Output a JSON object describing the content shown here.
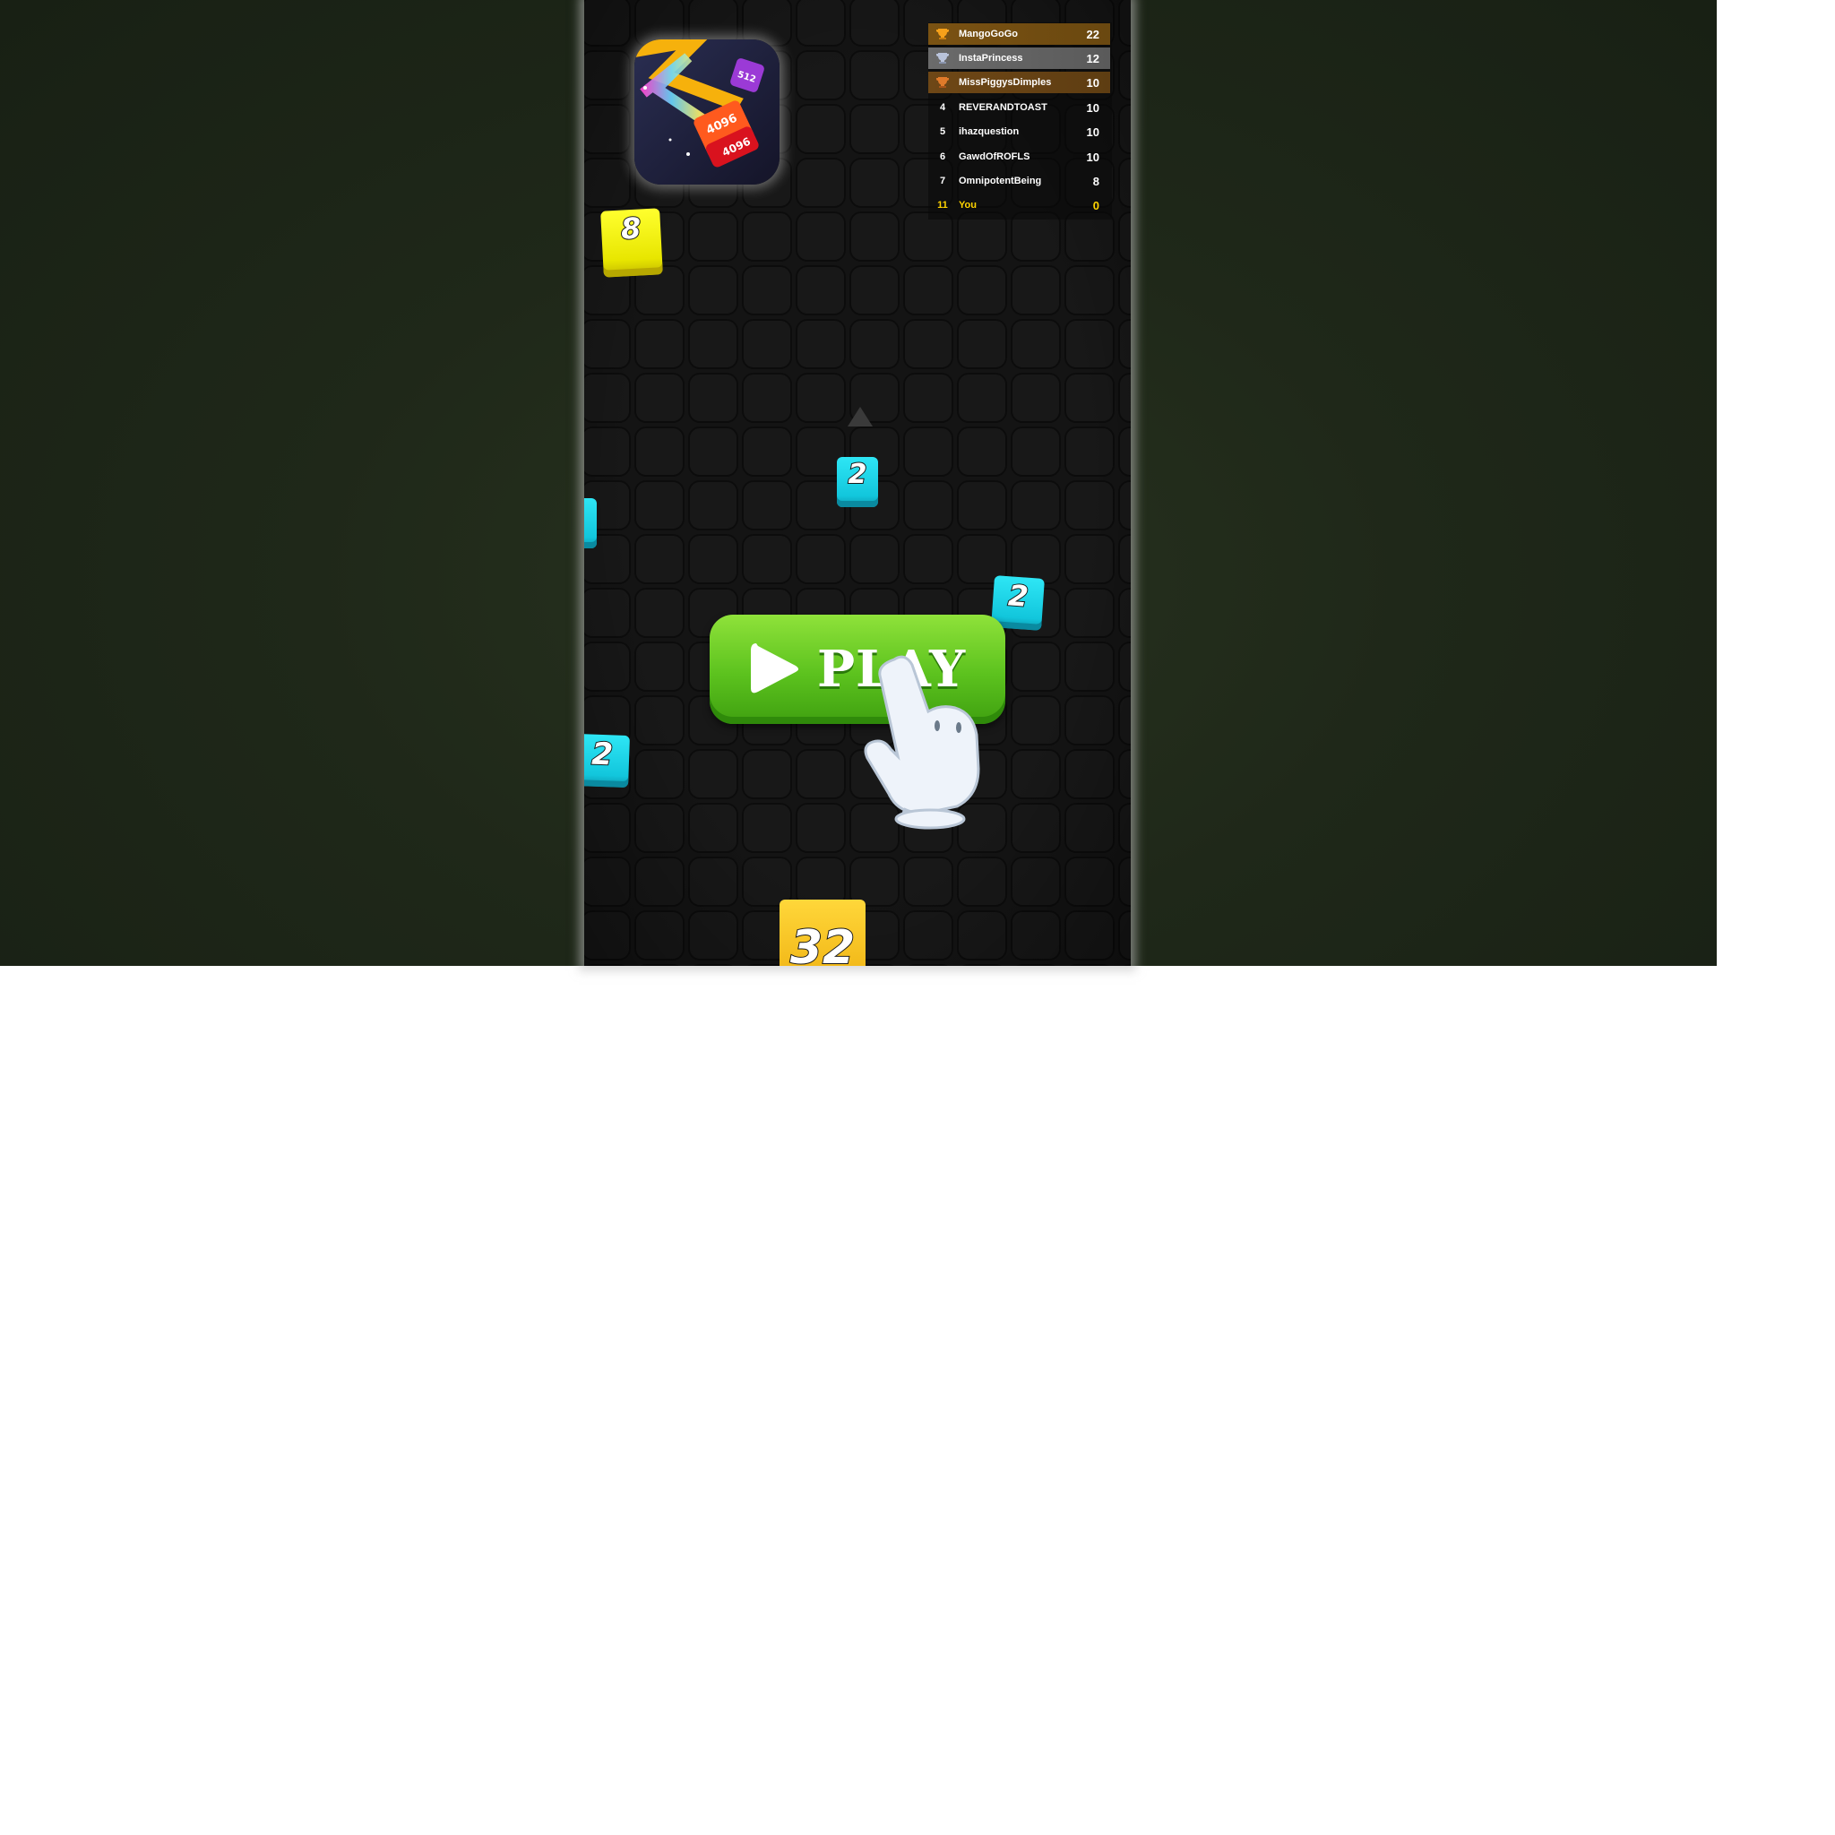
{
  "leaderboard": [
    {
      "rank": "",
      "name": "MangoGoGo",
      "score": "22",
      "trophy": "gold-trophy-icon"
    },
    {
      "rank": "",
      "name": "InstaPrincess",
      "score": "12",
      "trophy": "silver-trophy-icon"
    },
    {
      "rank": "",
      "name": "MissPiggysDimples",
      "score": "10",
      "trophy": "bronze-trophy-icon"
    },
    {
      "rank": "4",
      "name": "REVERANDTOAST",
      "score": "10"
    },
    {
      "rank": "5",
      "name": "ihazquestion",
      "score": "10"
    },
    {
      "rank": "6",
      "name": "GawdOfROFLS",
      "score": "10"
    },
    {
      "rank": "7",
      "name": "OmnipotentBeing",
      "score": "8"
    },
    {
      "rank": "11",
      "name": "You",
      "score": "0"
    }
  ],
  "play_button": {
    "label": "PLAY"
  },
  "logo": {
    "cube_labels": [
      "512",
      "4096",
      "4096"
    ]
  },
  "cubes": [
    {
      "id": "cube-8",
      "value": "8",
      "color": "yellow"
    },
    {
      "id": "cube-2-center",
      "value": "2",
      "color": "cyan"
    },
    {
      "id": "cube-2-right",
      "value": "2",
      "color": "cyan"
    },
    {
      "id": "cube-2-left",
      "value": "2",
      "color": "cyan"
    },
    {
      "id": "cube-32",
      "value": "32",
      "color": "gold"
    }
  ],
  "colors": {
    "background": "#1f2819",
    "board": "#141414",
    "cube_cyan": "#12c6dc",
    "cube_yellow": "#e8e600",
    "play_green": "#5cc21e",
    "you_highlight": "#ffd400"
  }
}
